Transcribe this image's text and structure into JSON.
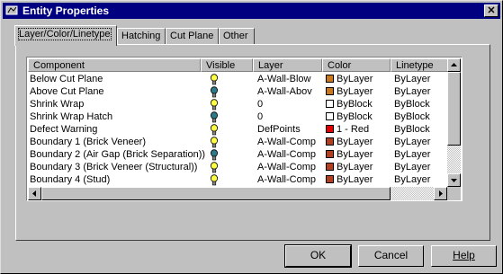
{
  "window": {
    "title": "Entity Properties",
    "close_glyph": "✕"
  },
  "tabs": [
    {
      "label": "Layer/Color/Linetype",
      "active": true
    },
    {
      "label": "Hatching"
    },
    {
      "label": "Cut Plane"
    },
    {
      "label": "Other"
    }
  ],
  "list": {
    "columns": [
      "Component",
      "Visible",
      "Layer",
      "Color",
      "Linetype"
    ],
    "rows": [
      {
        "component": "Below Cut Plane",
        "visible": "on",
        "layer": "A-Wall-Blow",
        "color_name": "ByLayer",
        "swatch": "#c8781e",
        "linetype": "ByLayer"
      },
      {
        "component": "Above Cut Plane",
        "visible": "off",
        "layer": "A-Wall-Abov",
        "color_name": "ByLayer",
        "swatch": "#c8781e",
        "linetype": "ByLayer"
      },
      {
        "component": "Shrink Wrap",
        "visible": "on",
        "layer": "0",
        "color_name": "ByBlock",
        "swatch": "#ffffff",
        "linetype": "ByBlock"
      },
      {
        "component": "Shrink Wrap Hatch",
        "visible": "off",
        "layer": "0",
        "color_name": "ByBlock",
        "swatch": "#ffffff",
        "linetype": "ByBlock"
      },
      {
        "component": "Defect Warning",
        "visible": "on",
        "layer": "DefPoints",
        "color_name": "1 - Red",
        "swatch": "#e00000",
        "linetype": "ByBlock"
      },
      {
        "component": "Boundary 1 (Brick Veneer)",
        "visible": "on",
        "layer": "A-Wall-Comp",
        "color_name": "ByLayer",
        "swatch": "#b04020",
        "linetype": "ByLayer"
      },
      {
        "component": "Boundary 2 (Air Gap (Brick Separation))",
        "visible": "off",
        "layer": "A-Wall-Comp",
        "color_name": "ByLayer",
        "swatch": "#b04020",
        "linetype": "ByLayer"
      },
      {
        "component": "Boundary 3 (Brick Veneer (Structural))",
        "visible": "on",
        "layer": "A-Wall-Comp",
        "color_name": "ByLayer",
        "swatch": "#b04020",
        "linetype": "ByLayer"
      },
      {
        "component": "Boundary 4 (Stud)",
        "visible": "on",
        "layer": "A-Wall-Comp",
        "color_name": "ByLayer",
        "swatch": "#b04020",
        "linetype": "ByLayer"
      }
    ]
  },
  "bulb_colors": {
    "on": "#ffff40",
    "off": "#2a7a8a"
  },
  "buttons": {
    "ok": "OK",
    "cancel": "Cancel",
    "help": "Help"
  }
}
